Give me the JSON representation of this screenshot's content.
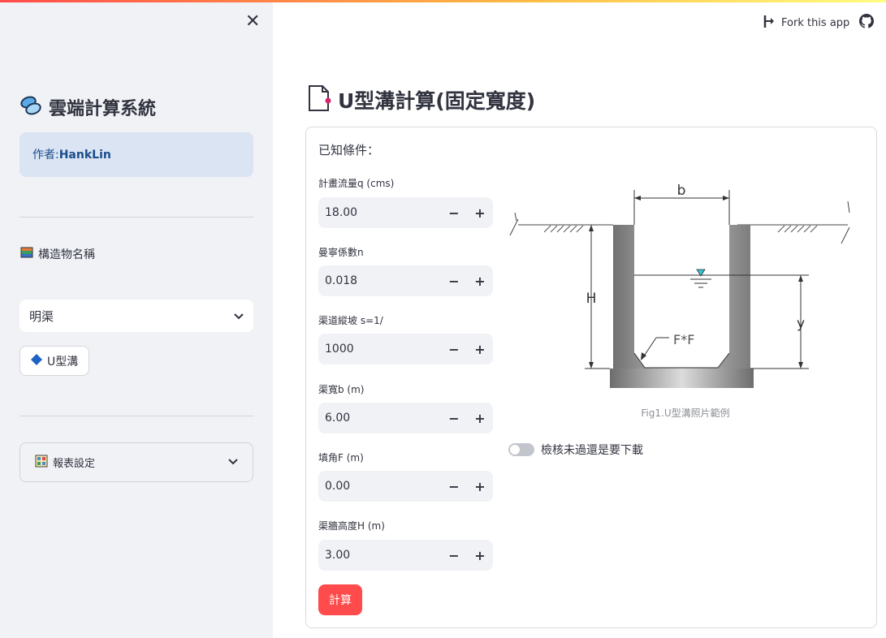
{
  "sidebar": {
    "app_title": "雲端計算系統",
    "author_prefix": "作者:",
    "author_name": "HankLin",
    "structure_label": "構造物名稱",
    "structure_select": "明渠",
    "type_button": "U型溝",
    "report_settings": "報表設定"
  },
  "header": {
    "fork_label": "Fork this app"
  },
  "main": {
    "title": "U型溝計算(固定寬度)",
    "known_label": "已知條件：",
    "fields": [
      {
        "label": "計畫流量q (cms)",
        "value": "18.00"
      },
      {
        "label": "曼寧係數n",
        "value": "0.018"
      },
      {
        "label": "渠道縱坡 s=1/",
        "value": "1000"
      },
      {
        "label": "渠寬b (m)",
        "value": "6.00"
      },
      {
        "label": "填角F (m)",
        "value": "0.00"
      },
      {
        "label": "渠牆高度H (m)",
        "value": "3.00"
      }
    ],
    "calc_button": "計算",
    "figure_caption": "Fig1.U型溝照片範例",
    "toggle_label": "檢核未過還是要下載",
    "diagram_labels": {
      "b": "b",
      "H": "H",
      "y": "y",
      "F": "F*F"
    }
  },
  "colors": {
    "primary": "#ff4b4b",
    "sidebar_bg": "#f0f2f6",
    "info_bg": "#dbe4f3",
    "info_text": "#1a4d8c"
  }
}
